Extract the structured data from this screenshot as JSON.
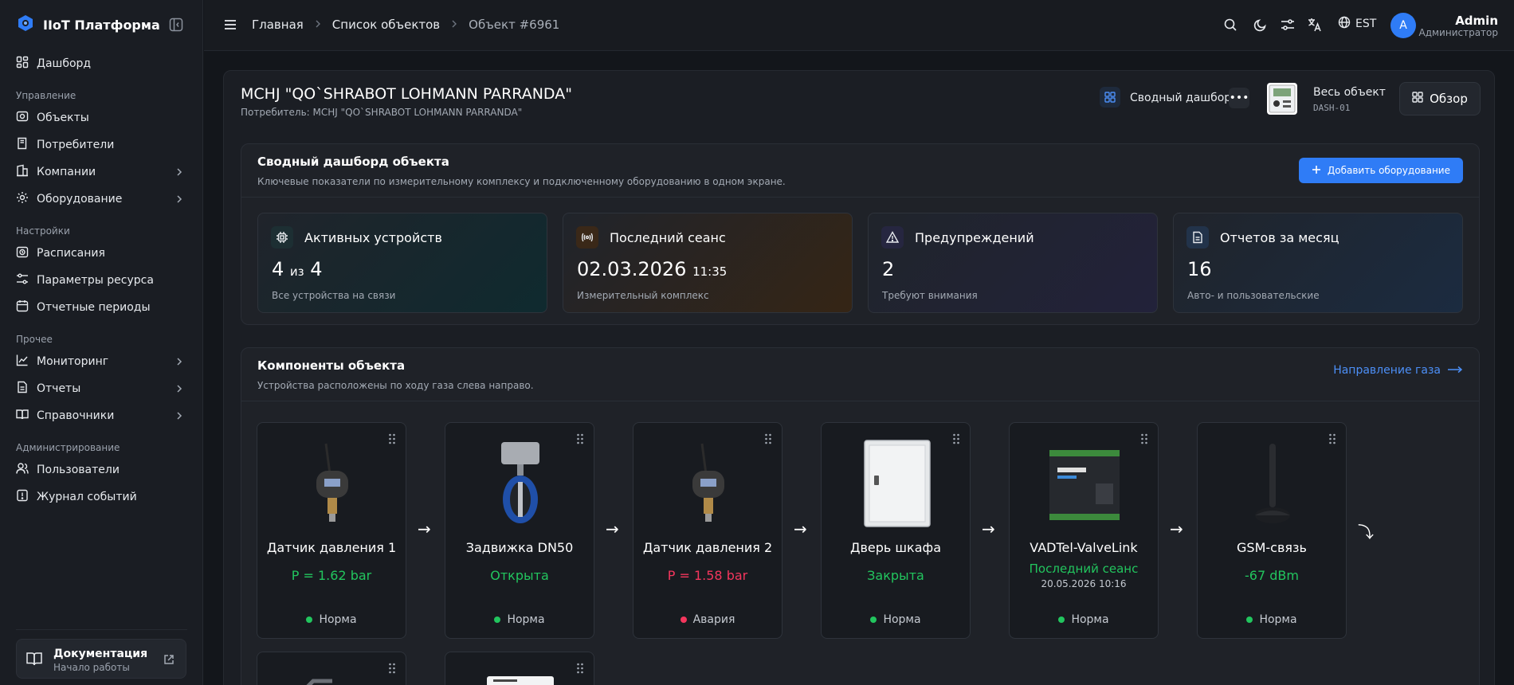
{
  "brand": {
    "name": "IIoT Платформа"
  },
  "sidebar": {
    "dashboard": "Дашборд",
    "sections": {
      "management": "Управление",
      "settings": "Настройки",
      "other": "Прочее",
      "admin": "Администрирование"
    },
    "items": {
      "objects": "Объекты",
      "consumers": "Потребители",
      "companies": "Компании",
      "equipment": "Оборудование",
      "schedules": "Расписания",
      "resource_params": "Параметры ресурса",
      "report_periods": "Отчетные периоды",
      "monitoring": "Мониторинг",
      "reports": "Отчеты",
      "references": "Справочники",
      "users": "Пользователи",
      "event_log": "Журнал событий"
    },
    "docs": {
      "title": "Документация",
      "subtitle": "Начало работы"
    }
  },
  "topbar": {
    "breadcrumbs": [
      "Главная",
      "Список объектов",
      "Объект #6961"
    ],
    "language": "EST",
    "user": {
      "initial": "A",
      "name": "Admin",
      "role": "Администратор"
    }
  },
  "object": {
    "title": "MCHJ \"QO`SHRABOT LOHMANN PARRANDA\"",
    "consumer": "Потребитель: MCHJ \"QO`SHRABOT LOHMANN PARRANDA\"",
    "summary_dashboard_label": "Сводный дашборд",
    "whole_object_label": "Весь объект",
    "whole_object_code": "DASH-01",
    "overview_label": "Обзор"
  },
  "summary": {
    "title": "Сводный дашборд объекта",
    "subtitle": "Ключевые показатели по измерительному комплексу и подключенному оборудованию в одном экране.",
    "add_button": "Добавить оборудование",
    "kpis": [
      {
        "title": "Активных устройств",
        "value_main": "4",
        "value_mid": "из",
        "value_end": "4",
        "sub": "Все устройства на связи",
        "accent": "#0f2a2f"
      },
      {
        "title": "Последний сеанс",
        "value_main": "02.03.2026",
        "value_time": "11:35",
        "sub": "Измерительный комплекс",
        "accent": "#352515"
      },
      {
        "title": "Предупреждений",
        "value_main": "2",
        "sub": "Требуют внимания",
        "accent": "#22223a"
      },
      {
        "title": "Отчетов за месяц",
        "value_main": "16",
        "sub": "Авто- и пользовательские",
        "accent": "#1b2b40"
      }
    ]
  },
  "components": {
    "title": "Компоненты объекта",
    "subtitle": "Устройства расположены по ходу газа слева направо.",
    "gas_direction": "Направление газа",
    "devices": [
      {
        "name": "Датчик давления 1",
        "value": "P = 1.62 bar",
        "status": "Норма",
        "value_color": "#22c55e",
        "status_color": "#22c55e"
      },
      {
        "name": "Задвижка DN50",
        "value": "Открыта",
        "status": "Норма",
        "value_color": "#22c55e",
        "status_color": "#22c55e"
      },
      {
        "name": "Датчик давления 2",
        "value": "P = 1.58 bar",
        "status": "Авария",
        "value_color": "#f4365d",
        "status_color": "#f4365d"
      },
      {
        "name": "Дверь шкафа",
        "value": "Закрыта",
        "status": "Норма",
        "value_color": "#22c55e",
        "status_color": "#22c55e"
      },
      {
        "name": "VADTel-ValveLink",
        "value": "Последний сеанс",
        "sub": "20.05.2026 10:16",
        "status": "Норма",
        "value_color": "#22c55e",
        "status_color": "#22c55e"
      },
      {
        "name": "GSM-связь",
        "value": "-67 dBm",
        "status": "Норма",
        "value_color": "#22c55e",
        "status_color": "#22c55e"
      }
    ]
  }
}
